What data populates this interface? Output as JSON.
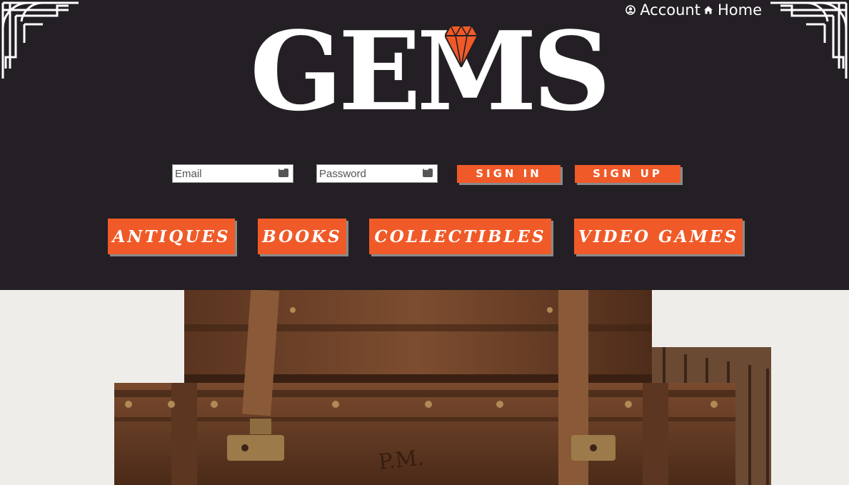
{
  "topnav": {
    "account_label": "Account",
    "home_label": "Home"
  },
  "brand": {
    "logo_text": "GEMS",
    "accent_color": "#f05a28"
  },
  "login": {
    "email_placeholder": "Email",
    "password_placeholder": "Password",
    "signin_label": "SIGN IN",
    "signup_label": "SIGN UP"
  },
  "categories": [
    "ANTIQUES",
    "BOOKS",
    "COLLECTIBLES",
    "VIDEO GAMES"
  ],
  "hero": {
    "icon": "stacked-vintage-suitcases-image",
    "monogram": "P.M."
  }
}
